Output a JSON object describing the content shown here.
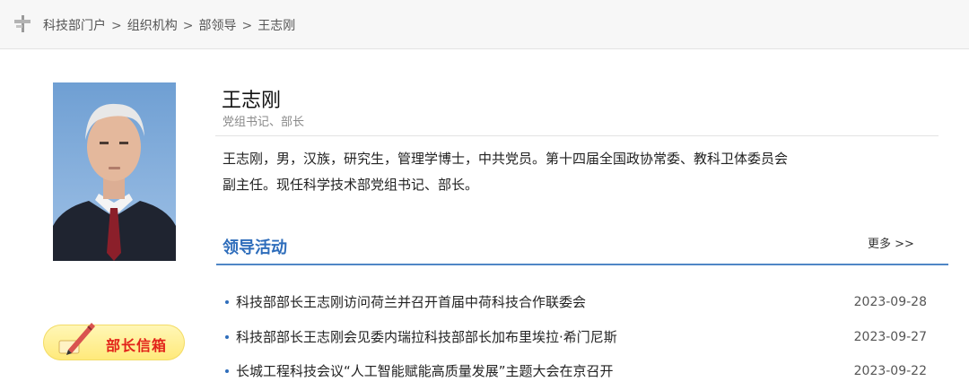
{
  "breadcrumb": {
    "items": [
      "科技部门户",
      "组织机构",
      "部领导",
      "王志刚"
    ],
    "separator": ">"
  },
  "profile": {
    "name": "王志刚",
    "position": "党组书记、部长",
    "bio_lines": [
      "王志刚，男，汉族，研究生，管理学博士，中共党员。第十四届全国政协常委、教科卫体委员会",
      "副主任。现任科学技术部党组书记、部长。"
    ]
  },
  "mailbox": {
    "label": "部长信箱"
  },
  "activities": {
    "title": "领导活动",
    "more_label": "更多 >>",
    "items": [
      {
        "title": "科技部部长王志刚访问荷兰并召开首届中荷科技合作联委会",
        "date": "2023-09-28"
      },
      {
        "title": "科技部部长王志刚会见委内瑞拉科技部部长加布里埃拉·希门尼斯",
        "date": "2023-09-27"
      },
      {
        "title": "长城工程科技会议“人工智能赋能高质量发展”主题大会在京召开",
        "date": "2023-09-22"
      }
    ]
  },
  "colors": {
    "accent": "#2e6dbb",
    "rule": "#4f86c6",
    "mailbox_text": "#e2231a",
    "mailbox_bg": "#ffe979"
  }
}
